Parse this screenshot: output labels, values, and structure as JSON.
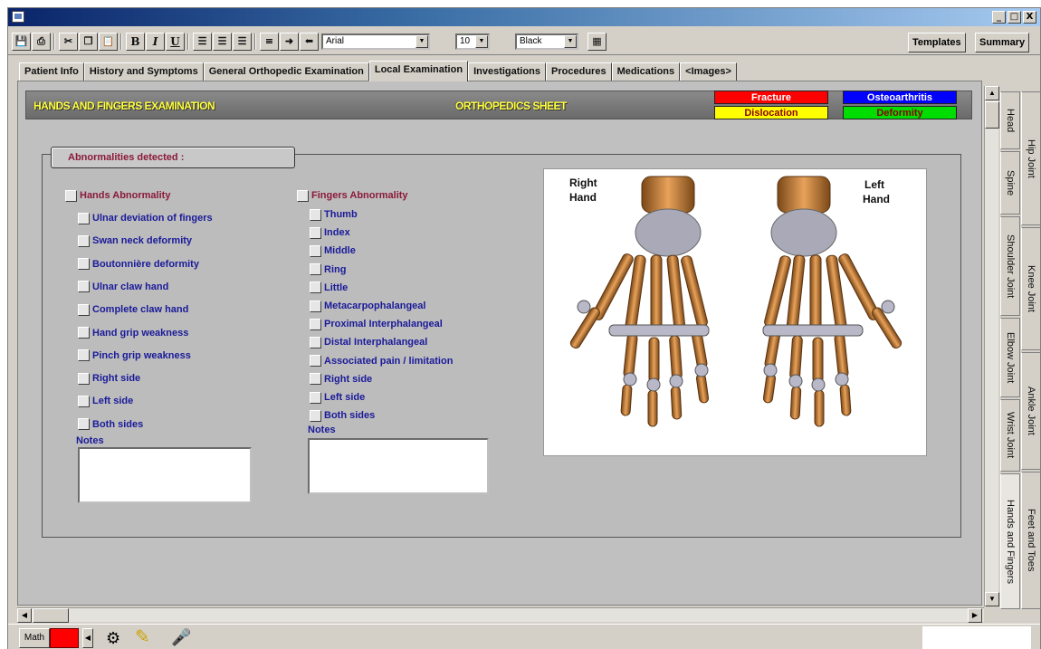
{
  "window": {
    "title": "",
    "controls": [
      "_",
      "□",
      "X"
    ]
  },
  "toolbar": {
    "font_name": "Arial",
    "font_size": "10",
    "font_color": "Black",
    "bold": "B",
    "italic": "I",
    "underline": "U",
    "templates_label": "Templates",
    "summary_label": "Summary"
  },
  "tabs": [
    {
      "label": "Patient Info"
    },
    {
      "label": "History and Symptoms"
    },
    {
      "label": "General Orthopedic Examination"
    },
    {
      "label": "Local Examination",
      "active": true
    },
    {
      "label": "Investigations"
    },
    {
      "label": "Procedures"
    },
    {
      "label": "Medications"
    },
    {
      "label": "<Images>"
    }
  ],
  "header": {
    "left_title": "HANDS AND FINGERS EXAMINATION",
    "center_title": "ORTHOPEDICS SHEET"
  },
  "legend": [
    {
      "label": "Fracture",
      "bg": "#ff0000",
      "fg": "#ffffff"
    },
    {
      "label": "Osteoarthritis",
      "bg": "#0000ff",
      "fg": "#ffffff"
    },
    {
      "label": "Dislocation",
      "bg": "#ffff00",
      "fg": "#8b0000"
    },
    {
      "label": "Deformity",
      "bg": "#00dd00",
      "fg": "#8b0000"
    }
  ],
  "section_title": "Abnormalities detected :",
  "hands": {
    "title": "Hands Abnormality",
    "items": [
      "Ulnar deviation of fingers",
      "Swan neck deformity",
      "Boutonnière deformity",
      "Ulnar claw hand",
      "Complete claw hand",
      "Hand grip weakness",
      "Pinch grip weakness",
      "Right side",
      "Left side",
      "Both sides"
    ],
    "notes_label": "Notes"
  },
  "fingers": {
    "title": "Fingers Abnormality",
    "items": [
      "Thumb",
      "Index",
      "Middle",
      "Ring",
      "Little",
      "Metacarpophalangeal",
      "Proximal Interphalangeal",
      "Distal Interphalangeal",
      "Associated pain / limitation",
      "Right side",
      "Left side",
      "Both sides"
    ],
    "notes_label": "Notes"
  },
  "image": {
    "right_label_1": "Right",
    "right_label_2": "Hand",
    "left_label_1": "Left",
    "left_label_2": "Hand"
  },
  "side_tabs": {
    "col1": [
      "Head",
      "Spine",
      "Shoulder Joint",
      "Elbow Joint",
      "Wrist Joint",
      "Hands and Fingers"
    ],
    "col2": [
      "Hip Joint",
      "Knee Joint",
      "Ankle Joint",
      "Feet and Toes"
    ]
  },
  "status": {
    "math_label": "Math",
    "swatch_color": "#ff0000"
  }
}
